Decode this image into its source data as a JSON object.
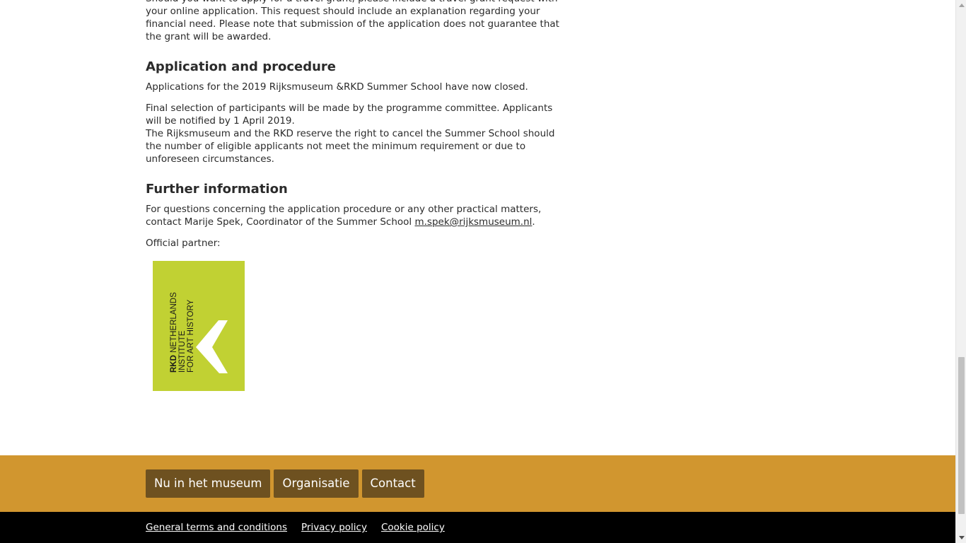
{
  "article": {
    "grant_para": "Should you want to apply for a travel grant, please include a travel grant request with your online application. This request should include an explanation regarding your financial need. Please note that submission of the application does not guarantee that the grant will be awarded.",
    "application_heading": "Application and procedure",
    "application_para1": "Applications for the 2019 Rijksmuseum &RKD Summer School have now closed.",
    "application_para2_line1": "Final selection of participants will be made by the programme committee. Applicants will be notified by 1 April 2019.",
    "application_para2_line2": "The Rijksmuseum and the RKD reserve the right to cancel the Summer School should the number of eligible applicants not meet the minimum requirement or due to unforeseen circumstances.",
    "further_heading": "Further information",
    "further_para": "For questions concerning the application procedure or any other practical matters, contact Marije Spek, Coordinator of the Summer School ",
    "contact_email": "m.spek@rijksmuseum.nl",
    "further_para_end": ".",
    "partner_label": "Official partner:"
  },
  "partner_logo": {
    "text_line1_bold": "RKD",
    "text_line1_rest": " NETHERLANDS",
    "text_line2": "INSTITUTE",
    "text_line3": "FOR ART HISTORY",
    "background_color": "#c1d133",
    "mark_color": "#ffffff"
  },
  "footer": {
    "nav": [
      {
        "label": "Nu in het museum"
      },
      {
        "label": "Organisatie"
      },
      {
        "label": "Contact"
      }
    ],
    "legal": [
      {
        "label": "General terms and conditions "
      },
      {
        "label": "Privacy policy "
      },
      {
        "label": "Cookie policy"
      }
    ],
    "accent_color": "#d1962f",
    "button_color": "#6e5120",
    "bottom_color": "#000000"
  }
}
